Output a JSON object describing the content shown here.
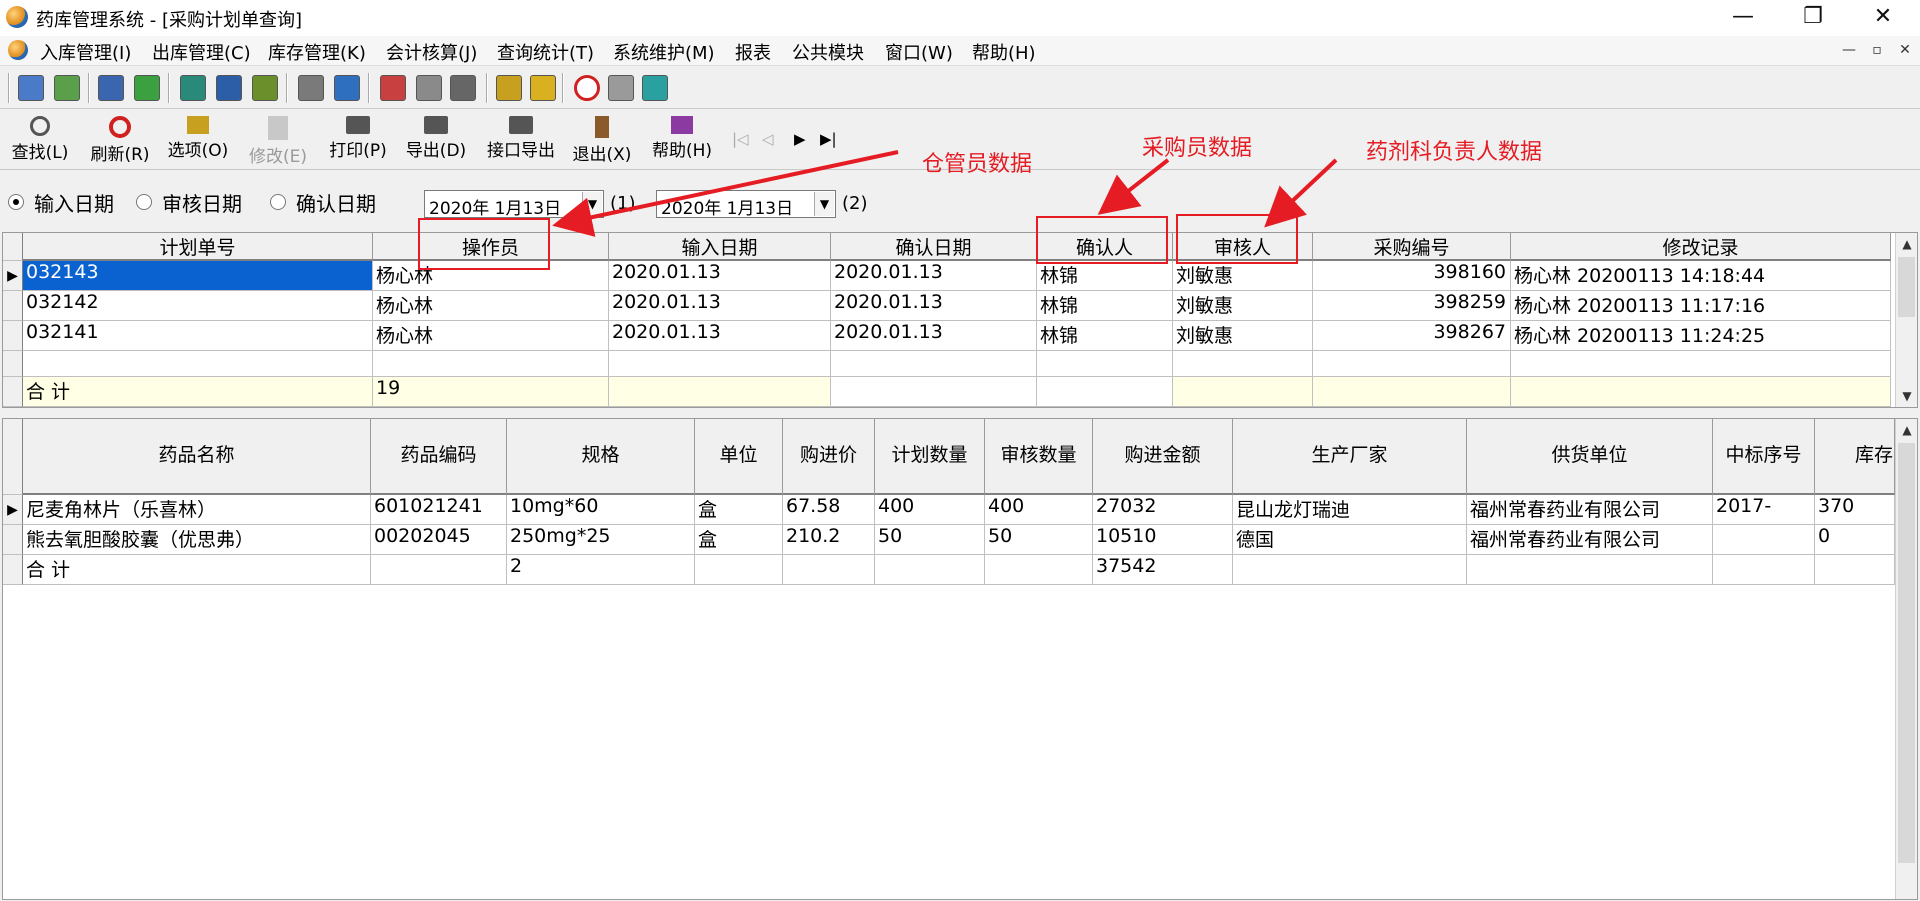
{
  "window": {
    "title": "药库管理系统 - [采购计划单查询]",
    "min": "—",
    "restore": "❐",
    "close": "✕"
  },
  "menu": [
    "入库管理(I)",
    "出库管理(C)",
    "库存管理(K)",
    "会计核算(J)",
    "查询统计(T)",
    "系统维护(M)",
    "报表",
    "公共模块",
    "窗口(W)",
    "帮助(H)"
  ],
  "mdi": {
    "min": "—",
    "restore": "▫",
    "close": "✕"
  },
  "toolbar2": [
    {
      "label": "查找(L)",
      "icon": "magnifier-icon"
    },
    {
      "label": "刷新(R)",
      "icon": "refresh-icon"
    },
    {
      "label": "选项(O)",
      "icon": "options-icon"
    },
    {
      "label": "修改(E)",
      "icon": "edit-icon"
    },
    {
      "label": "打印(P)",
      "icon": "printer-icon"
    },
    {
      "label": "导出(D)",
      "icon": "export-printer-icon"
    },
    {
      "label": "接口导出",
      "icon": "interface-export-icon"
    },
    {
      "label": "退出(X)",
      "icon": "exit-door-icon"
    },
    {
      "label": "帮助(H)",
      "icon": "help-book-icon"
    }
  ],
  "nav": [
    "|◁",
    "◁",
    "▶",
    "▶|"
  ],
  "filter": {
    "radios": [
      "输入日期",
      "审核日期",
      "确认日期"
    ],
    "date_from": "2020年  1月13日",
    "date_to": "2020年  1月13日",
    "spin1": "(1)",
    "spin2": "(2)"
  },
  "grid1": {
    "headers": [
      "计划单号",
      "操作员",
      "输入日期",
      "确认日期",
      "确认人",
      "审核人",
      "采购编号",
      "修改记录"
    ],
    "rows": [
      [
        "032143",
        "杨心林",
        "2020.01.13",
        "2020.01.13",
        "林锦",
        "刘敏惠",
        "398160",
        "杨心林   20200113 14:18:44"
      ],
      [
        "032142",
        "杨心林",
        "2020.01.13",
        "2020.01.13",
        "林锦",
        "刘敏惠",
        "398259",
        "杨心林   20200113 11:17:16"
      ],
      [
        "032141",
        "杨心林",
        "2020.01.13",
        "2020.01.13",
        "林锦",
        "刘敏惠",
        "398267",
        "杨心林   20200113 11:24:25"
      ],
      [
        "",
        "",
        "",
        "",
        "",
        "",
        "",
        ""
      ]
    ],
    "total": [
      "合  计",
      "19",
      "",
      "",
      "",
      "",
      "",
      ""
    ]
  },
  "grid2": {
    "headers": [
      "药品名称",
      "药品编码",
      "规格",
      "单位",
      "购进价",
      "计划数量",
      "审核数量",
      "购进金额",
      "生产厂家",
      "供货单位",
      "中标序号",
      "库存"
    ],
    "rows": [
      [
        "尼麦角林片（乐喜林）",
        "601021241",
        "10mg*60",
        "盒",
        "67.58",
        "400",
        "400",
        "27032",
        "昆山龙灯瑞迪",
        "福州常春药业有限公司",
        "2017-",
        "370"
      ],
      [
        "熊去氧胆酸胶囊（优思弗）",
        "00202045",
        "250mg*25",
        "盒",
        "210.2",
        "50",
        "50",
        "10510",
        "德国",
        "福州常春药业有限公司",
        "",
        "0"
      ]
    ],
    "total": [
      "合 计",
      "",
      "2",
      "",
      "",
      "",
      "",
      "37542",
      "",
      "",
      "",
      ""
    ]
  },
  "annotations": {
    "warehouse": "仓管员数据",
    "purchaser": "采购员数据",
    "pharmacy_head": "药剂科负责人数据"
  },
  "colors": {
    "annotation": "#e51c23",
    "selection": "#0a62d0",
    "total_row": "#ffffe6"
  }
}
